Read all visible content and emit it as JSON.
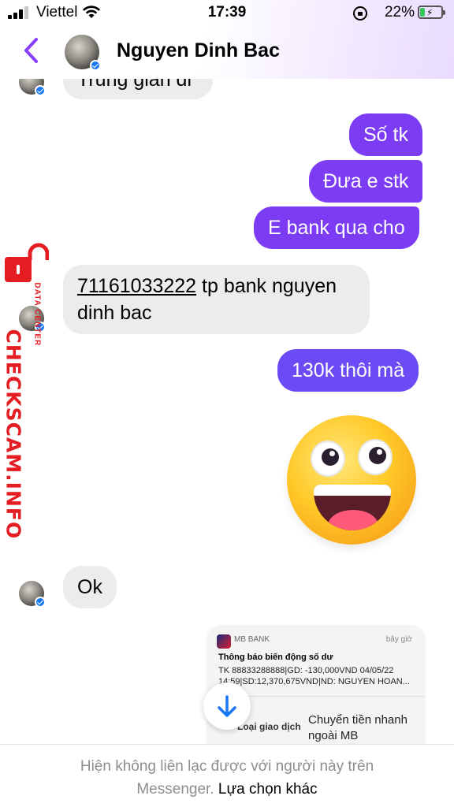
{
  "status_bar": {
    "carrier": "Viettel",
    "time": "17:39",
    "battery": "22%",
    "battery_level": 0.22,
    "icons": [
      "signal-icon",
      "wifi-icon",
      "rotation-lock-icon",
      "battery-charging-icon"
    ]
  },
  "header": {
    "contact_name": "Nguyen Dinh Bac",
    "back_icon": "chevron-left-icon",
    "accent": "#8a3ffc"
  },
  "messages": [
    {
      "from": "them",
      "text": "Trung gian đi"
    },
    {
      "from": "me",
      "text": "Số tk"
    },
    {
      "from": "me",
      "text": "Đưa e stk"
    },
    {
      "from": "me",
      "text": "E bank qua cho"
    },
    {
      "from": "them",
      "account_number": "71161033222",
      "text_rest": " tp bank nguyen",
      "text_line2": "dinh bac"
    },
    {
      "from": "me",
      "text": "130k thôi mà"
    },
    {
      "from": "me",
      "type": "emoji",
      "emoji": "grinning-face-big-eyes"
    },
    {
      "from": "them",
      "text": "Ok"
    },
    {
      "from": "me",
      "type": "image",
      "notification": {
        "app": "MB BANK",
        "time": "bây giờ",
        "title": "Thông báo biến động số dư",
        "body_line1": "TK 88833288888|GD: -130,000VND 04/05/22",
        "body_line2": "14:59|SD:12,370,675VND|ND: NGUYEN HOAN...",
        "field_label": "Loại giao dịch",
        "field_value_line1": "Chuyển tiền nhanh",
        "field_value_line2": "ngoài MB"
      }
    }
  ],
  "colors": {
    "outgoing_bubble": "#7b3cf4",
    "incoming_bubble": "#ececec",
    "verified_badge": "#1877f2"
  },
  "watermark": {
    "main": "CHECKSCAM.INFO",
    "sub": "DATA CENTER",
    "color": "#e31d22"
  },
  "footer": {
    "notice_line1": "Hiện không liên lạc được với người này trên",
    "notice_line2_prefix": "Messenger.",
    "link": "Lựa chọn khác"
  }
}
